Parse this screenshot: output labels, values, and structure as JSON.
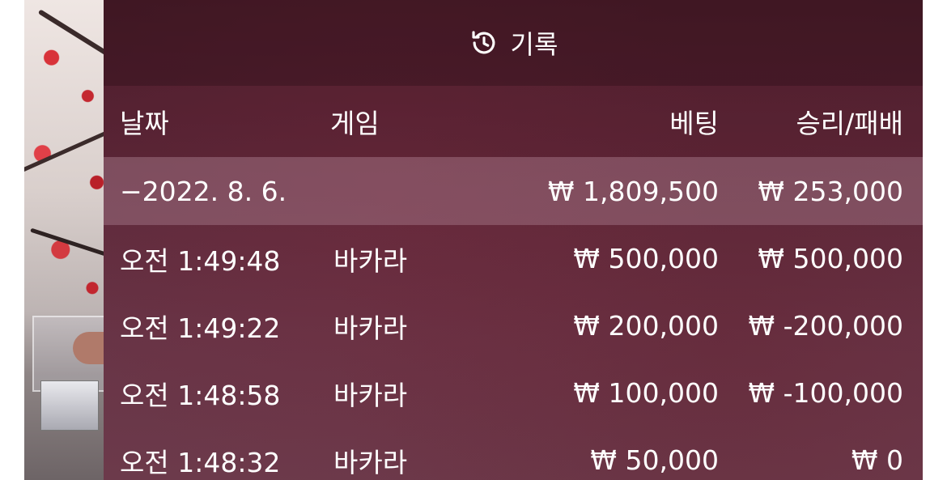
{
  "panel": {
    "title": "기록",
    "icon": "history-icon"
  },
  "columns": [
    "날짜",
    "게임",
    "베팅",
    "승리/패배"
  ],
  "date_group": {
    "date": "−2022. 8. 6.",
    "bet_total": "₩ 1,809,500",
    "result_total": "₩ 253,000"
  },
  "rows": [
    {
      "time": "오전 1:49:48",
      "game": "바카라",
      "bet": "₩ 500,000",
      "result": "₩ 500,000"
    },
    {
      "time": "오전 1:49:22",
      "game": "바카라",
      "bet": "₩ 200,000",
      "result": "₩ -200,000"
    },
    {
      "time": "오전 1:48:58",
      "game": "바카라",
      "bet": "₩ 100,000",
      "result": "₩ -100,000"
    },
    {
      "time": "오전 1:48:32",
      "game": "바카라",
      "bet": "₩ 50,000",
      "result": "₩ 0"
    }
  ],
  "colors": {
    "panel_bg": "#5c2839",
    "header_bg": "#3a1220",
    "date_row_bg": "#8f6070",
    "text": "#ffffff"
  }
}
